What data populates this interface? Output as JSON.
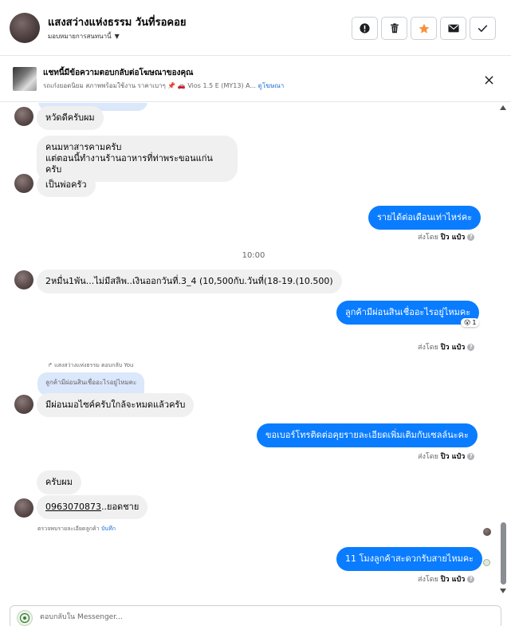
{
  "header": {
    "name": "แสงสว่างแห่งธรรม วันที่รอคอย",
    "assign_label": "มอบหมายการสนทนานี้",
    "buttons": [
      "mark-spam",
      "delete",
      "star",
      "unread",
      "done"
    ]
  },
  "ad_bar": {
    "title": "แชทนี้มีข้อความตอบกลับต่อโฆษณาของคุณ",
    "subtitle": "รถเก๋งยอดนิยม สภาพพร้อมใช้งาน ราคาเบาๆ 📌 🚗 Vios 1.5 E (MY13) A...",
    "link": "ดูโฆษณา"
  },
  "messages": {
    "m1": "หวัดดีครับผม",
    "m2_line1": "คนมหาสารคามครับ",
    "m2_line2": "แต่ตอนนี้ทำงานร้านอาหารที่ท่าพระขอนแก่นครับ",
    "m3": "เป็นพ่อครัว",
    "m4": "รายได้ต่อเดือนเท่าไหร่คะ",
    "time": "10:00",
    "m5": "2หมื่น1พัน...ไม่มีสลิพ..เงินออกวันที่.3_4  (10,500กับ.วันที่(18-19.(10.500)",
    "m6": "ลูกค้ามีผ่อนสินเชื่ออะไรอยู่ไหมคะ",
    "m6_reaction": "😮",
    "m6_reaction_count": "1",
    "reply_hint": "แสงสว่างแห่งธรรม ตอบกลับ You",
    "quote": "ลูกค้ามีผ่อนสินเชื่ออะไรอยู่ไหมคะ",
    "m7": "มีผ่อนมอไซค์ครับใกล้จะหมดแล้วครับ",
    "m8": "ขอเบอร์โทรติดต่อคุยรายละเอียดเพิ่มเติมกับเซลล์นะคะ",
    "m9": "ครับผม",
    "m10_phone": "0963070873",
    "m10_rest": "..ยอดชาย",
    "note": "ตรวจพบรายละเอียดลูกค้า",
    "note_link": "บันทึก",
    "m11": "11 โมงลูกค้าสะดวกรับสายไหมคะ"
  },
  "sent_by": {
    "prefix": "ส่งโดย",
    "name": "ปิว แป๋ว"
  },
  "composer": {
    "placeholder": "ตอบกลับใน Messenger..."
  },
  "colors": {
    "outgoing_bubble": "#0a7cff",
    "incoming_bubble": "#f0f0f0",
    "star_accent": "#f7923a",
    "link": "#216fdb"
  }
}
